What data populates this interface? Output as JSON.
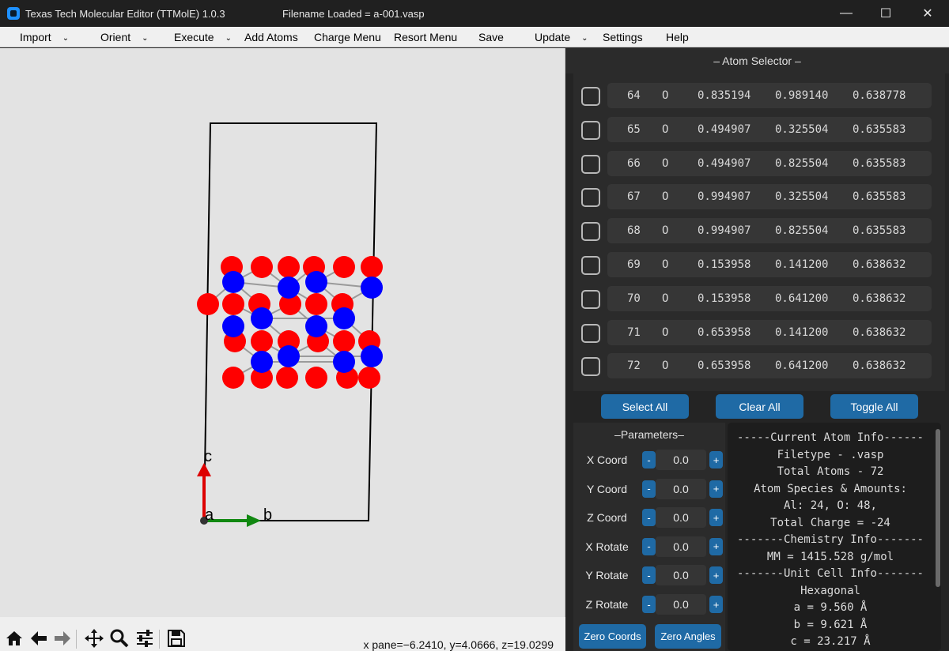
{
  "window": {
    "app_title": "Texas Tech Molecular Editor (TTMolE) 1.0.3",
    "file_title": "Filename Loaded = a-001.vasp",
    "minimize": "—",
    "maximize": "☐",
    "close": "✕"
  },
  "menu": [
    {
      "label": "Import",
      "chevron": "⌄"
    },
    {
      "label": "Orient",
      "chevron": "⌄"
    },
    {
      "label": "Execute",
      "chevron": "⌄"
    },
    {
      "label": "Add Atoms",
      "chevron": ""
    },
    {
      "label": "Charge Menu",
      "chevron": ""
    },
    {
      "label": "Resort Menu",
      "chevron": ""
    },
    {
      "label": "Save",
      "chevron": ""
    },
    {
      "label": "Update",
      "chevron": "⌄"
    },
    {
      "label": "Settings",
      "chevron": ""
    },
    {
      "label": "Help",
      "chevron": ""
    }
  ],
  "plot": {
    "axis_labels": {
      "c": "c",
      "a": "a",
      "b": "b"
    },
    "colors": {
      "O": "#ff0000",
      "Al": "#0000ff",
      "bond": "#9a9a9a",
      "c_axis": "#dd0000",
      "b_axis": "#118811"
    },
    "coord_readout": "x pane=−6.2410, y=4.0666, z=19.0299"
  },
  "toolbar": {
    "icons": [
      "home-icon",
      "back-arrow-icon",
      "forward-arrow-icon",
      "pan-icon",
      "zoom-icon",
      "configure-icon",
      "save-figure-icon"
    ]
  },
  "atom_selector": {
    "title": "– Atom Selector –",
    "rows": [
      {
        "index": "64",
        "element": "O",
        "x": "0.835194",
        "y": "0.989140",
        "z": "0.638778",
        "checked": false
      },
      {
        "index": "65",
        "element": "O",
        "x": "0.494907",
        "y": "0.325504",
        "z": "0.635583",
        "checked": false
      },
      {
        "index": "66",
        "element": "O",
        "x": "0.494907",
        "y": "0.825504",
        "z": "0.635583",
        "checked": false
      },
      {
        "index": "67",
        "element": "O",
        "x": "0.994907",
        "y": "0.325504",
        "z": "0.635583",
        "checked": false
      },
      {
        "index": "68",
        "element": "O",
        "x": "0.994907",
        "y": "0.825504",
        "z": "0.635583",
        "checked": false
      },
      {
        "index": "69",
        "element": "O",
        "x": "0.153958",
        "y": "0.141200",
        "z": "0.638632",
        "checked": false
      },
      {
        "index": "70",
        "element": "O",
        "x": "0.153958",
        "y": "0.641200",
        "z": "0.638632",
        "checked": false
      },
      {
        "index": "71",
        "element": "O",
        "x": "0.653958",
        "y": "0.141200",
        "z": "0.638632",
        "checked": false
      },
      {
        "index": "72",
        "element": "O",
        "x": "0.653958",
        "y": "0.641200",
        "z": "0.638632",
        "checked": false
      }
    ],
    "select_all": "Select All",
    "clear_all": "Clear All",
    "toggle_all": "Toggle All"
  },
  "parameters": {
    "title": "–Parameters–",
    "rows": [
      {
        "label": "X Coord",
        "value": "0.0",
        "minus": "-",
        "plus": "+"
      },
      {
        "label": "Y Coord",
        "value": "0.0",
        "minus": "-",
        "plus": "+"
      },
      {
        "label": "Z Coord",
        "value": "0.0",
        "minus": "-",
        "plus": "+"
      },
      {
        "label": "X Rotate",
        "value": "0.0",
        "minus": "-",
        "plus": "+"
      },
      {
        "label": "Y Rotate",
        "value": "0.0",
        "minus": "-",
        "plus": "+"
      },
      {
        "label": "Z Rotate",
        "value": "0.0",
        "minus": "-",
        "plus": "+"
      }
    ],
    "zero_coords": "Zero Coords",
    "zero_angles": "Zero Angles"
  },
  "info": {
    "lines": [
      "-----Current Atom Info------",
      "Filetype - .vasp",
      "Total Atoms - 72",
      "Atom Species & Amounts:",
      "Al: 24, O: 48,",
      "Total Charge = -24",
      "-------Chemistry Info-------",
      "MM = 1415.528 g/mol",
      "-------Unit Cell Info-------",
      "Hexagonal",
      "a = 9.560 Å",
      "b = 9.621 Å",
      "c = 23.217 Å"
    ]
  }
}
